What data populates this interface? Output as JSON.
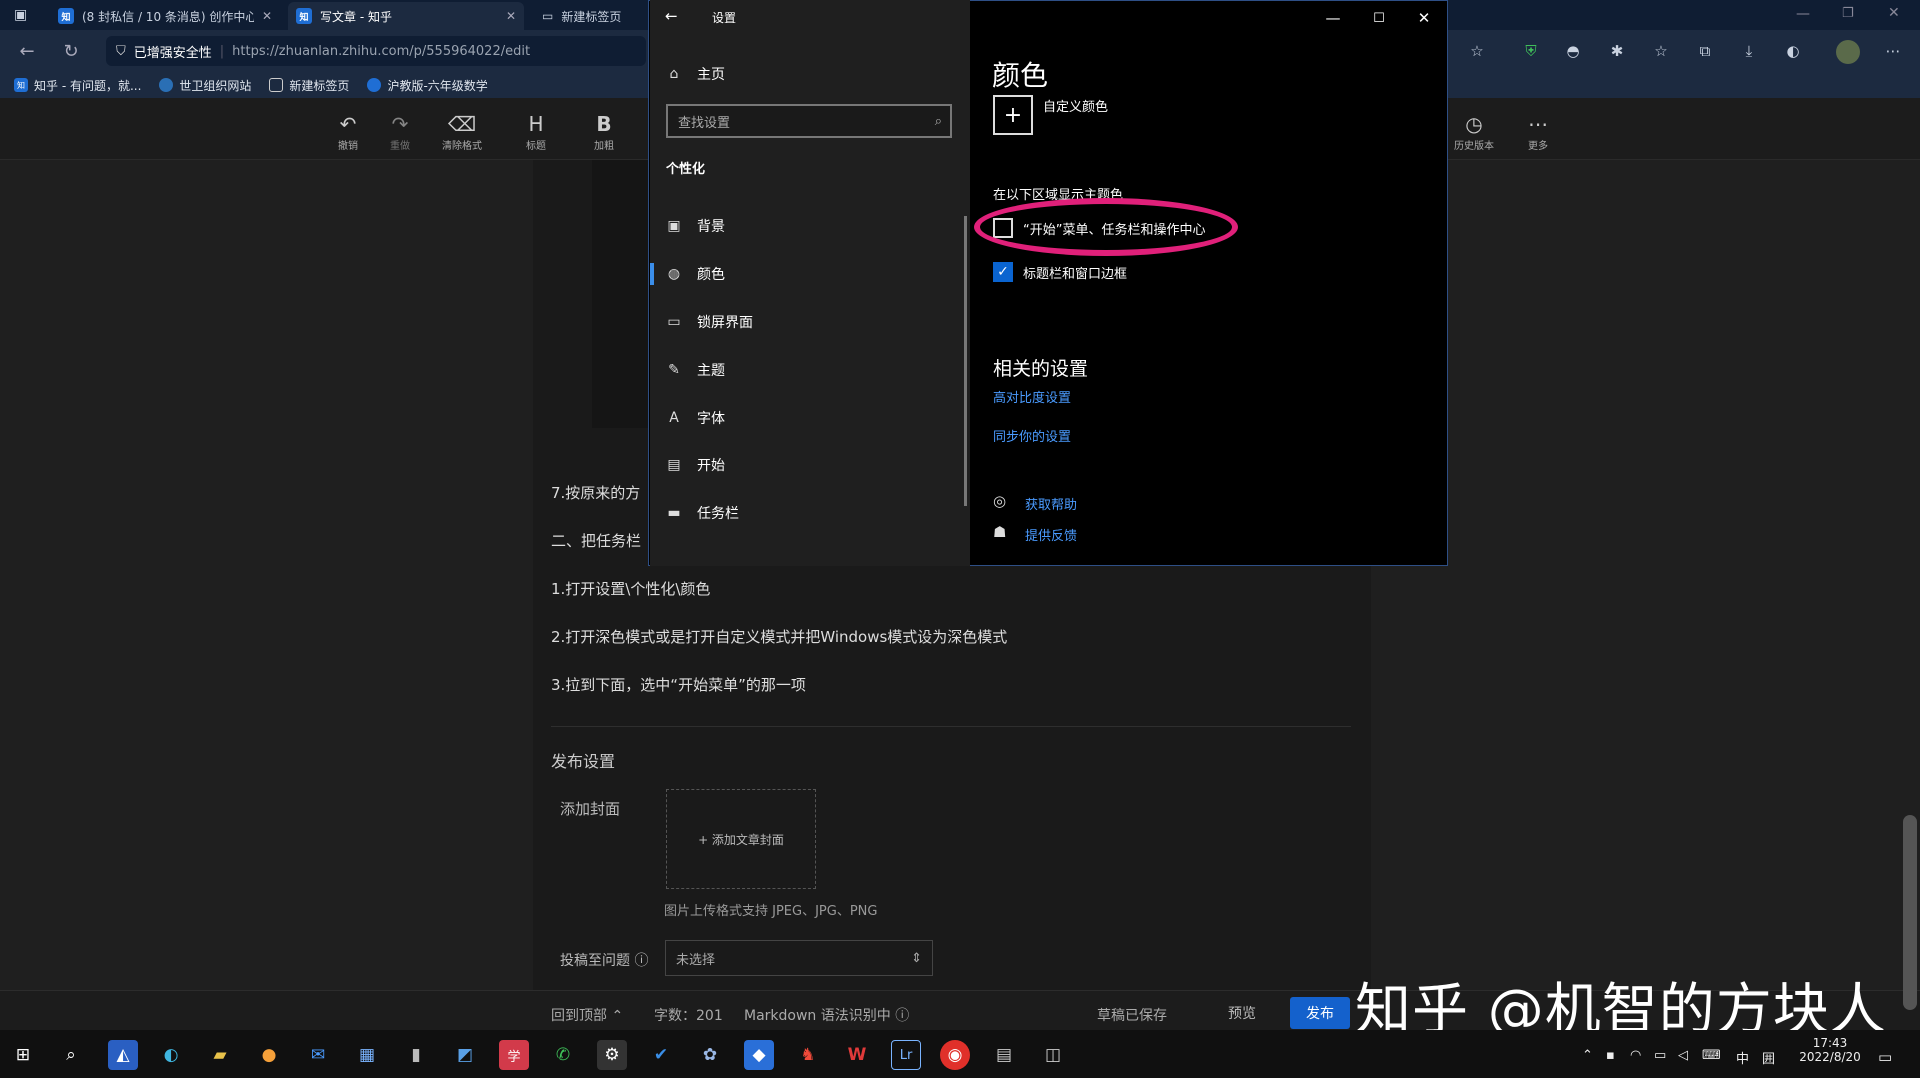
{
  "browser": {
    "tabs": [
      {
        "label": "(8 封私信 / 10 条消息) 创作中心"
      },
      {
        "label": "写文章 - 知乎"
      },
      {
        "label": "新建标签页"
      }
    ],
    "security": "已增强安全性",
    "url": "https://zhuanlan.zhihu.com/p/555964022/edit",
    "bookmarks": [
      {
        "label": "知乎 - 有问题，就..."
      },
      {
        "label": "世卫组织网站"
      },
      {
        "label": "新建标签页"
      },
      {
        "label": "沪教版-六年级数学"
      }
    ]
  },
  "toolbar": {
    "undo": "撤销",
    "redo": "重做",
    "clear": "清除格式",
    "heading": "标题",
    "bold": "加粗",
    "history": "历史版本",
    "more": "更多"
  },
  "article": {
    "p1": "7.按原来的方",
    "p2": "二、把任务栏",
    "p3": "1.打开设置\\个性化\\颜色",
    "p4": "2.打开深色模式或是打开自定义模式并把Windows模式设为深色模式",
    "p5": "3.拉到下面，选中“开始菜单”的那一项"
  },
  "publish": {
    "heading": "发布设置",
    "cover_label": "添加封面",
    "cover_button": "+ 添加文章封面",
    "cover_hint": "图片上传格式支持 JPEG、JPG、PNG",
    "question_label": "投稿至问题",
    "question_value": "未选择"
  },
  "bottom": {
    "top": "回到顶部",
    "count": "字数：201",
    "markdown": "Markdown 语法识别中",
    "saved": "草稿已保存",
    "preview": "预览",
    "publish": "发布"
  },
  "watermark": "知乎 @机智的方块人",
  "settings": {
    "title": "设置",
    "home": "主页",
    "search_placeholder": "查找设置",
    "section": "个性化",
    "nav": [
      {
        "label": "背景",
        "icon": "image-icon"
      },
      {
        "label": "颜色",
        "icon": "palette-icon"
      },
      {
        "label": "锁屏界面",
        "icon": "lock-screen-icon"
      },
      {
        "label": "主题",
        "icon": "theme-icon"
      },
      {
        "label": "字体",
        "icon": "font-icon"
      },
      {
        "label": "开始",
        "icon": "start-icon"
      },
      {
        "label": "任务栏",
        "icon": "taskbar-icon"
      }
    ],
    "page_title": "颜色",
    "custom_color": "自定义颜色",
    "accent_heading": "在以下区域显示主题色",
    "option_start": "“开始”菜单、任务栏和操作中心",
    "option_title": "标题栏和窗口边框",
    "related_heading": "相关的设置",
    "link_contrast": "高对比度设置",
    "link_sync": "同步你的设置",
    "help": "获取帮助",
    "feedback": "提供反馈",
    "option_start_checked": false,
    "option_title_checked": true
  },
  "taskbar": {
    "ime": "中",
    "time": "17:43",
    "date": "2022/8/20"
  },
  "colors": {
    "accent": "#0a64d0",
    "highlight": "#e0207a",
    "link": "#4a9bff"
  }
}
